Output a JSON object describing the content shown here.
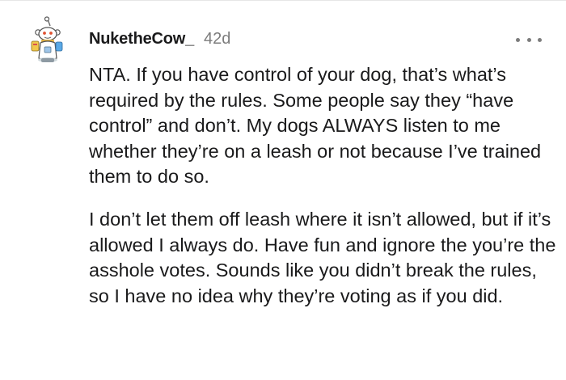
{
  "comment": {
    "author": "NuketheCow_",
    "age": "42d",
    "more_icon": "more-horizontal-icon",
    "avatar_icon": "snoo-avatar-icon",
    "paragraphs": [
      "NTA. If you have control of your dog, that’s what’s required by the rules. Some people say they “have control” and don’t. My dogs ALWAYS listen to me whether they’re on a leash or not because I’ve trained them to do so.",
      "I don’t let them off leash where it isn’t allowed, but if it’s allowed I always do. Have fun and ignore the you’re the asshole votes. Sounds like you didn’t break the rules, so I have no idea why they’re voting as if you did."
    ]
  },
  "colors": {
    "text": "#1a1a1b",
    "meta": "#7c7c7c",
    "divider": "#e6e6e6"
  }
}
